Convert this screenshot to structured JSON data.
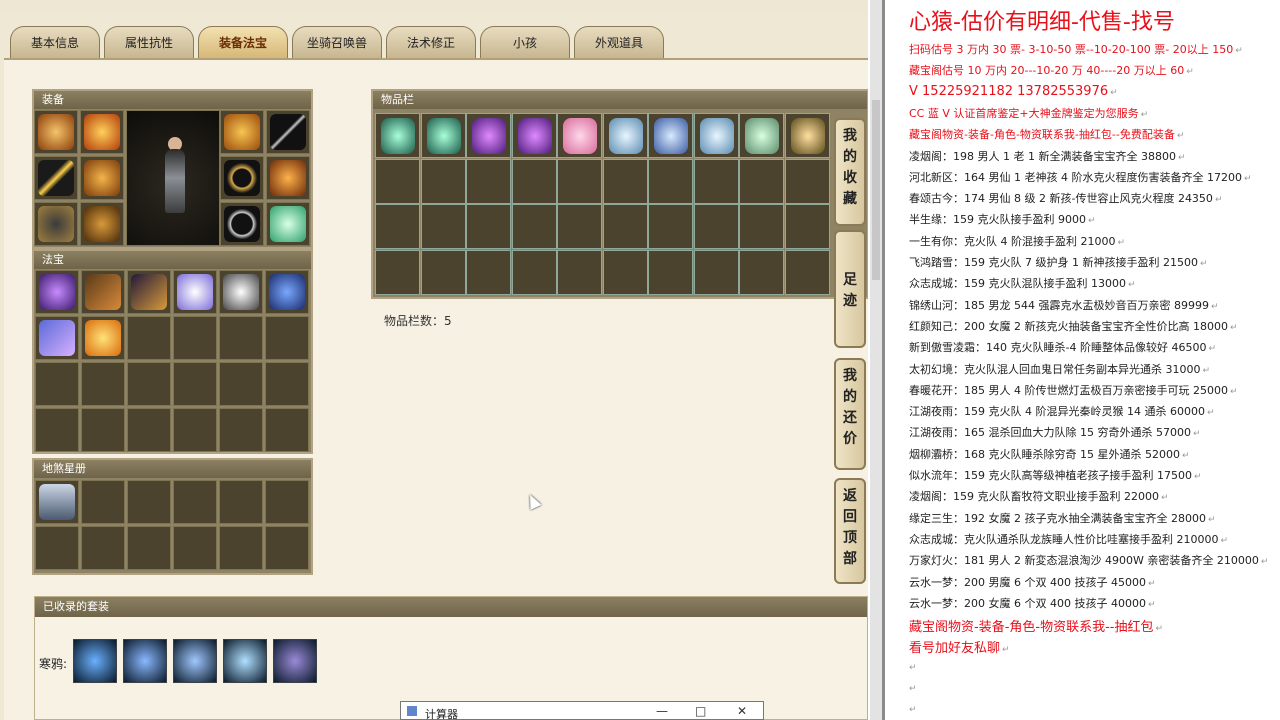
{
  "tabs": [
    "基本信息",
    "属性抗性",
    "装备法宝",
    "坐骑召唤兽",
    "法术修正",
    "小孩",
    "外观道具"
  ],
  "active_tab": "装备法宝",
  "panels": {
    "equipment": "装备",
    "treasure": "法宝",
    "star_book": "地煞星册",
    "inventory": "物品栏",
    "suits": "已收录的套装"
  },
  "inventory_count": "物品栏数：5",
  "side_buttons": [
    "我的收藏",
    "足迹",
    "我的还价",
    "返回顶部"
  ],
  "suit_label": "寒鸦:",
  "calculator_title": "计算器",
  "notes": {
    "title": "心猿-估价有明细-代售-找号",
    "lines": [
      {
        "text": "扫码估号 3 万内 30 票- 3-10-50 票--10-20-100 票- 20以上 150",
        "red": true
      },
      {
        "text": "藏宝阁估号 10 万内 20---10-20 万 40----20 万以上 60",
        "red": true
      },
      {
        "text": " V 15225921182   13782553976",
        "red": true,
        "big": true
      },
      {
        "text": "CC 蓝 V 认证首席鉴定+大神金牌鉴定为您服务",
        "red": true
      },
      {
        "text": "藏宝阁物资-装备-角色-物资联系我-抽红包--免费配装备",
        "red": true
      },
      {
        "text": "凌烟阁：198 男人 1 老 1 新全满装备宝宝齐全 38800"
      },
      {
        "text": "河北新区：164 男仙 1 老神孩 4 阶水克火程度伤害装备齐全 17200"
      },
      {
        "text": "春颂古今：174 男仙 8 级 2 新孩-传世容止风克火程度 24350"
      },
      {
        "text": "半生缘：159 克火队接手盈利 9000"
      },
      {
        "text": "一生有你：克火队 4 阶混接手盈利 21000"
      },
      {
        "text": "飞鸿踏雪：159 克火队 7 级护身 1 新神孩接手盈利 21500"
      },
      {
        "text": "众志成城：159 克火队混队接手盈利 13000"
      },
      {
        "text": "锦绣山河：185 男龙 544 强霹克水盂极妙音百万亲密 89999"
      },
      {
        "text": "红颜知己：200 女魔 2 新孩克火抽装备宝宝齐全性价比高 18000"
      },
      {
        "text": "新到傲雪凌霜：140 克火队睡杀-4 阶睡整体品像较好 46500"
      },
      {
        "text": "太初幻境：克火队混人回血鬼日常任务副本异光通杀 31000"
      },
      {
        "text": "春暖花开：185 男人 4 阶传世燃灯盂极百万亲密接手可玩 25000"
      },
      {
        "text": "江湖夜雨：159 克火队 4 阶混异光秦岭灵猴 14 通杀 60000"
      },
      {
        "text": "江湖夜雨：165 混杀回血大力队除 15 穷奇外通杀 57000"
      },
      {
        "text": "烟柳灞桥：168 克火队睡杀除穷奇 15 星外通杀 52000"
      },
      {
        "text": "似水流年：159 克火队高等级神植老孩子接手盈利 17500"
      },
      {
        "text": "凌烟阁：159 克火队畜牧符文职业接手盈利 22000"
      },
      {
        "text": "缘定三生：192 女魔 2 孩子克水抽全满装备宝宝齐全 28000"
      },
      {
        "text": "众志成城：克火队通杀队龙族睡人性价比哇塞接手盈利 210000"
      },
      {
        "text": "万家灯火：181 男人 2 新変态混浪淘沙 4900W 亲密装备齐全 210000"
      },
      {
        "text": "云水一梦：200 男魔 6 个双 400 技孩子 45000"
      },
      {
        "text": "云水一梦：200 女魔 6 个双 400 技孩子 40000"
      },
      {
        "text": "藏宝阁物资-装备-角色-物资联系我--抽红包",
        "red": true,
        "big": true
      },
      {
        "text": "看号加好友私聊",
        "red": true,
        "big": true
      }
    ]
  },
  "colors": {
    "accent_red": "#e8101a",
    "panel_brown": "#6f6449",
    "slot_dark": "#4c432e"
  },
  "icons": {
    "equipment": [
      "hat-icon",
      "armor-icon",
      "sword-icon",
      "robe-icon",
      "belt-icon",
      "boots-icon",
      "helmet-icon",
      "chain-icon",
      "ring-icon",
      "bracelet-icon",
      "necklace-icon",
      "orb-icon"
    ],
    "treasure": [
      "gem-icon",
      "bag-icon",
      "lute-icon",
      "flower-icon",
      "mirror-icon",
      "gauntlet-icon",
      "scroll-icon",
      "lotus-icon"
    ],
    "inventory": [
      "jade-leaf-icon",
      "jade-leaf-icon",
      "purple-crystal-icon",
      "purple-crystal-icon",
      "heart-stone-icon",
      "ice-stone-icon",
      "blue-crystal-icon",
      "ice-stone-icon",
      "green-stone-icon",
      "dragon-token-icon"
    ],
    "star_book": [
      "warrior-portrait-icon"
    ],
    "suits": [
      "suit-1-icon",
      "suit-2-icon",
      "suit-3-icon",
      "suit-4-icon",
      "suit-5-icon"
    ]
  }
}
